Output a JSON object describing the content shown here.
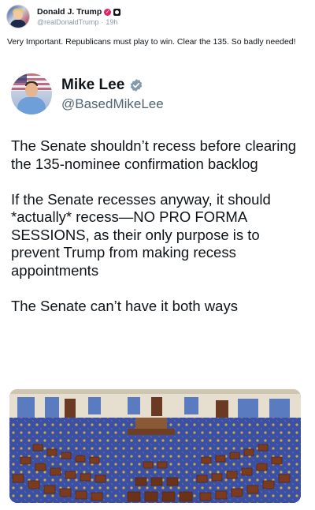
{
  "post": {
    "author_name": "Donald J. Trump",
    "handle": "@realDonaldTrump",
    "separator": "·",
    "time": "19h",
    "text": "Very Important. Republicans must play to win. Clear the 135. So badly needed!",
    "badges": [
      "verified-icon",
      "account-badge-icon"
    ]
  },
  "quoted_post": {
    "author_name": "Mike Lee",
    "handle": "@BasedMikeLee",
    "verified_color": "#829aab",
    "paragraphs": [
      "The Senate shouldn’t recess before clearing the 135-nominee confirmation backlog",
      "If the Senate recesses anyway, it should *actually* recess—NO PRO FORMA SESSIONS, as their only purpose is to prevent Trump from making recess appointments",
      "The Senate can’t have it both ways"
    ],
    "media": {
      "kind": "photo",
      "subject": "senate-chamber-photo"
    }
  },
  "colors": {
    "text": "#0f1419",
    "muted": "#536471",
    "carpet_blue": "#3b4fa3",
    "desk_brown": "#7a3b1f"
  }
}
